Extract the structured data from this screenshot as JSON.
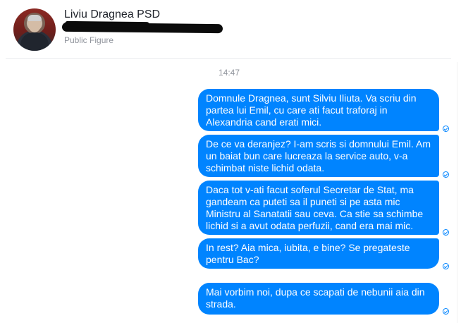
{
  "header": {
    "contact_name": "Liviu Dragnea PSD",
    "subtitle": "Public Figure"
  },
  "conversation": {
    "timestamp": "14:47",
    "messages": [
      {
        "text": "Domnule Dragnea, sunt Silviu Iliuta. Va scriu din partea lui Emil, cu care ati facut traforaj in Alexandria cand erati mici.",
        "status": "seen"
      },
      {
        "text": "De ce va deranjez? I-am scris si domnului Emil. Am un baiat bun care lucreaza la service auto, v-a schimbat niste lichid odata.",
        "status": "seen"
      },
      {
        "text": "Daca tot v-ati facut soferul Secretar de Stat, ma gandeam ca puteti sa il puneti si pe asta mic Ministru al Sanatatii sau ceva. Ca stie sa schimbe lichid si a avut odata perfuzii, cand era mai mic.",
        "status": "seen"
      },
      {
        "text": "In rest? Aia mica, iubita, e bine? Se pregateste pentru Bac?",
        "status": "seen"
      },
      {
        "text": "Mai vorbim noi, dupa ce scapati de nebunii aia din strada.",
        "status": "seen"
      }
    ]
  },
  "colors": {
    "bubble_blue": "#0084ff",
    "muted_text": "#90949c",
    "divider": "#e9ebee"
  }
}
